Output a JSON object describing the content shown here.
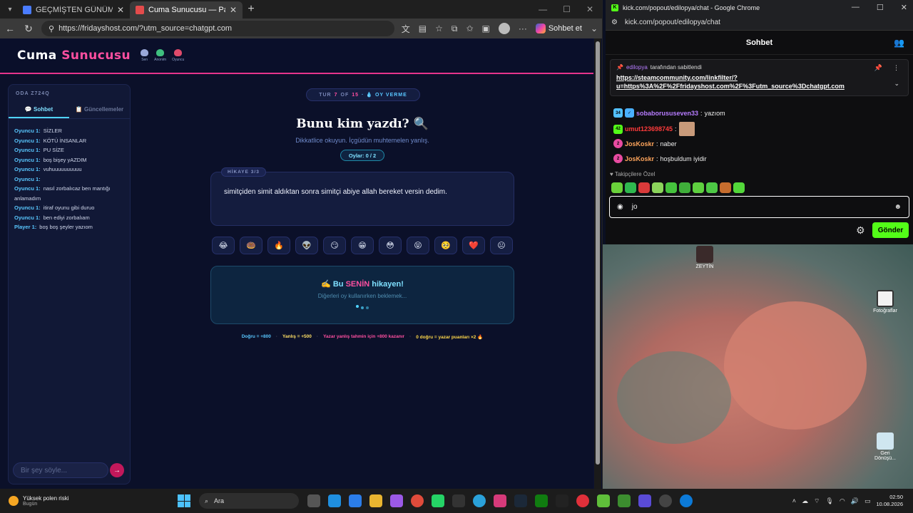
{
  "left_browser": {
    "tabs": [
      {
        "title": "GEÇMİŞTEN GÜNÜMÜZE TOPUKLU",
        "active": false,
        "favicon_color": "#4a7cff"
      },
      {
        "title": "Cuma Sunucusu — Parti Oyunu",
        "active": true,
        "favicon_color": "#e34b4b"
      }
    ],
    "url": "https://fridayshost.com/?utm_source=chatgpt.com",
    "copilot_label": "Sohbet et"
  },
  "site": {
    "logo_white": "Cuma",
    "logo_pink": "Sunucusu",
    "header_icons": [
      {
        "label": "Sen",
        "color": "#9aa8d8"
      },
      {
        "label": "Anonim",
        "color": "#3fbf7f"
      },
      {
        "label": "Oyuncu",
        "color": "#e04b6b"
      }
    ]
  },
  "sidebar": {
    "room": "ODA Z724Q",
    "tabs": [
      {
        "label": "💬 Sohbet",
        "active": true
      },
      {
        "label": "📋 Güncellemeler",
        "active": false
      }
    ],
    "messages": [
      {
        "who": "Oyuncu 1:",
        "text": "SİZLER"
      },
      {
        "who": "Oyuncu 1:",
        "text": "KÖTÜ İNSANLAR"
      },
      {
        "who": "Oyuncu 1:",
        "text": "PU SİZE"
      },
      {
        "who": "Oyuncu 1:",
        "text": "boş bişey yAZDIM"
      },
      {
        "who": "Oyuncu 1:",
        "text": "vuhuuuuuuuuuu"
      },
      {
        "who": "Oyuncu 1:",
        "text": ""
      },
      {
        "who": "Oyuncu 1:",
        "text": "nasıl zorbalıcaz ben mantığı anlamadım"
      },
      {
        "who": "Oyuncu 1:",
        "text": "itiraf oyunu gibi duruo"
      },
      {
        "who": "Oyuncu 1:",
        "text": "ben ediyi zorbalıam"
      },
      {
        "who": "Player 1:",
        "text": "boş boş şeyler yazıom"
      }
    ],
    "input_placeholder": "Bir şey söyle...",
    "send_label": "→"
  },
  "game": {
    "round_prefix": "TUR",
    "round_num": "7",
    "round_of": "OF",
    "round_total": "15",
    "phase": "· 💧 OY VERME",
    "title": "Bunu kim yazdı? 🔍",
    "subtitle": "Dikkatlice okuyun. İçgüdün muhtemelen yanlış.",
    "votes": "Oylar: 0 / 2",
    "story_tag": "HİKAYE 3/3",
    "story_text": "simitçiden simit aldıktan sonra simitçi abiye allah bereket versin dedim.",
    "reactions": [
      "😂",
      "🍩",
      "🔥",
      "👽",
      "😏",
      "😁",
      "😳",
      "😝",
      "🥺",
      "❤️",
      "😐"
    ],
    "yours_icon": "✍️",
    "yours_pre": "Bu",
    "yours_hl": "SENİN",
    "yours_post": "hikayen!",
    "yours_sub": "Diğerleri oy kullanırken beklemek...",
    "scoring": {
      "correct": "Doğru = +800",
      "wrong": "Yanlış = +500",
      "author": "Yazar yanlış tahmin için +800 kazanır",
      "zero": "0 doğru = yazar puanları ×2 🔥"
    }
  },
  "chat_window": {
    "title": "kick.com/popout/edilopya/chat - Google Chrome",
    "url": "kick.com/popout/edilopya/chat",
    "header": "Sohbet",
    "pinned": {
      "by_user": "edilopya",
      "by_text": "tarafından sabitlendi",
      "link": "https://steamcommunity.com/linkfilter/?u=https%3A%2F%2Ffridayshost.com%2F%3Futm_source%3Dchatgpt.com"
    },
    "messages": [
      {
        "nick": "sobaborususeven33",
        "text": "yazıom",
        "color": "#b77cff"
      },
      {
        "nick": "umut123698745",
        "text": "",
        "color": "#ff3b3b"
      },
      {
        "nick": "JosKoskr",
        "text": "naber",
        "color": "#ffa55c"
      },
      {
        "nick": "JosKoskr",
        "text": "hoşbuldum iyidir",
        "color": "#ffa55c"
      }
    ],
    "followers_label": "♥ Takipçilere Özel",
    "input_value": "jo",
    "send_label": "Gönder"
  },
  "desktop": {
    "icons": [
      {
        "label": "ZEYTİN"
      },
      {
        "label": "Fotoğraflar"
      },
      {
        "label": "Geri Dönüşü..."
      }
    ]
  },
  "taskbar": {
    "weather_line1": "Yüksek polen riski",
    "weather_line2": "Bugün",
    "search_label": "Ara",
    "time": "02:50",
    "date": "10.08.2026"
  }
}
